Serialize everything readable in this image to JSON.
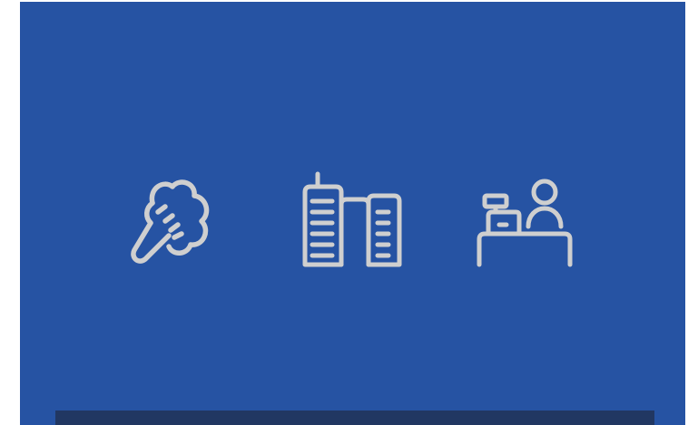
{
  "colors": {
    "panel_background": "#2653a3",
    "icon_stroke": "#cfcfcf",
    "bottom_bar": "#213762",
    "page_background": "#ffffff"
  },
  "icons": [
    {
      "name": "broccoli-icon"
    },
    {
      "name": "city-buildings-icon"
    },
    {
      "name": "cashier-register-icon"
    }
  ]
}
